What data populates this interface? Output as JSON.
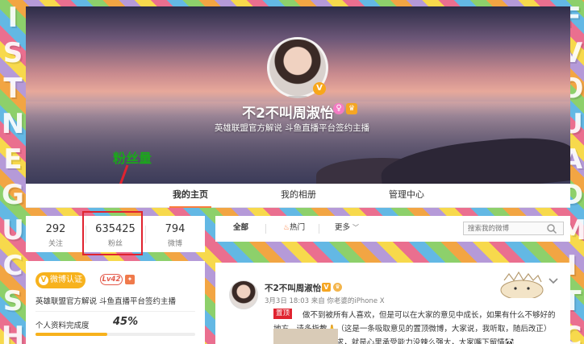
{
  "background": {
    "left_letters": [
      "I",
      "S",
      "T",
      "N",
      "E",
      "G",
      "U",
      "C",
      "S",
      "H"
    ],
    "right_letters": [
      "F",
      "V",
      "O",
      "U",
      "A",
      "D",
      "M",
      "I",
      "T",
      "C"
    ]
  },
  "cover": {
    "name": "不2不叫周淑怡",
    "description": "英雄联盟官方解说 斗鱼直播平台签约主播",
    "avatar_badge": "V"
  },
  "annotation": {
    "label": "粉丝量",
    "color": "#1ba71b",
    "highlight_color": "#e0232f"
  },
  "nav": {
    "tabs": [
      "我的主页",
      "我的相册",
      "管理中心"
    ],
    "active_tab": "我的主页",
    "accent": "#fa7d3c"
  },
  "stats": [
    {
      "value": "292",
      "label": "关注"
    },
    {
      "value": "635425",
      "label": "粉丝"
    },
    {
      "value": "794",
      "label": "微博"
    }
  ],
  "profile": {
    "verify_label": "微博认证",
    "level": "Lv42",
    "description": "英雄联盟官方解说 斗鱼直播平台签约主播",
    "completion_label": "个人资料完成度",
    "completion_value": "45%",
    "completion_fraction": 0.45
  },
  "filter": {
    "all": "全部",
    "hot": "热门",
    "more": "更多",
    "search_placeholder": "搜索我的微博"
  },
  "post": {
    "author": "不2不叫周淑怡",
    "meta": "3月3日 18:03 来自 你老婆的iPhone X",
    "pin_label": "置顶",
    "text": "做不到被所有人喜欢，但是可以在大家的意见中成长，如果有什么不够好的地方，请多指教🙏（这是一条吸取意见的置顶微博，大家说，我听取，随后改正）Emmm. 有个小恳求，就是心里承受能力没辣么强大，大家嘴下留情🐼"
  },
  "colors": {
    "brand_orange": "#f7b21d",
    "pin_red": "#e0232f"
  }
}
